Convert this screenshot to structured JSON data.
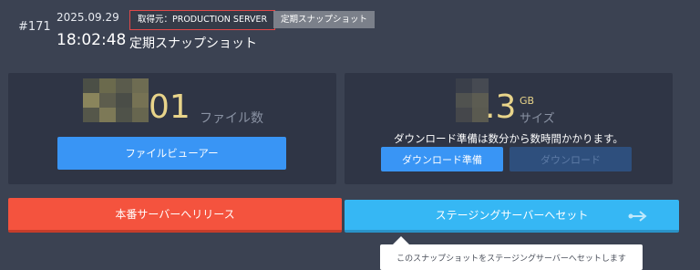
{
  "snapshot": {
    "id": "#171",
    "date": "2025.09.29",
    "time": "18:02:48",
    "source_badge": "取得元：PRODUCTION SERVER",
    "type_badge": "定期スナップショット",
    "title": "定期スナップショット"
  },
  "files": {
    "count_visible": "01",
    "label": "ファイル数",
    "viewer_button": "ファイルビューアー"
  },
  "size": {
    "value_visible": ".3",
    "unit": "GB",
    "label": "サイズ",
    "notice": "ダウンロード準備は数分から数時間かかります。",
    "prepare_button": "ダウンロード準備",
    "download_button": "ダウンロード"
  },
  "actions": {
    "release_button": "本番サーバーへリリース",
    "staging_button": "ステージングサーバーへセット",
    "staging_tooltip": "このスナップショットをステージングサーバーへセットします"
  },
  "colors": {
    "background": "#3b4252",
    "panel": "#2f3545",
    "accent_gold": "#e8d48a",
    "primary_blue": "#3995f5",
    "danger_red": "#f4533e",
    "staging_cyan": "#36b7f4"
  },
  "icons": {
    "staging_arrow": "arrow-right-icon"
  }
}
